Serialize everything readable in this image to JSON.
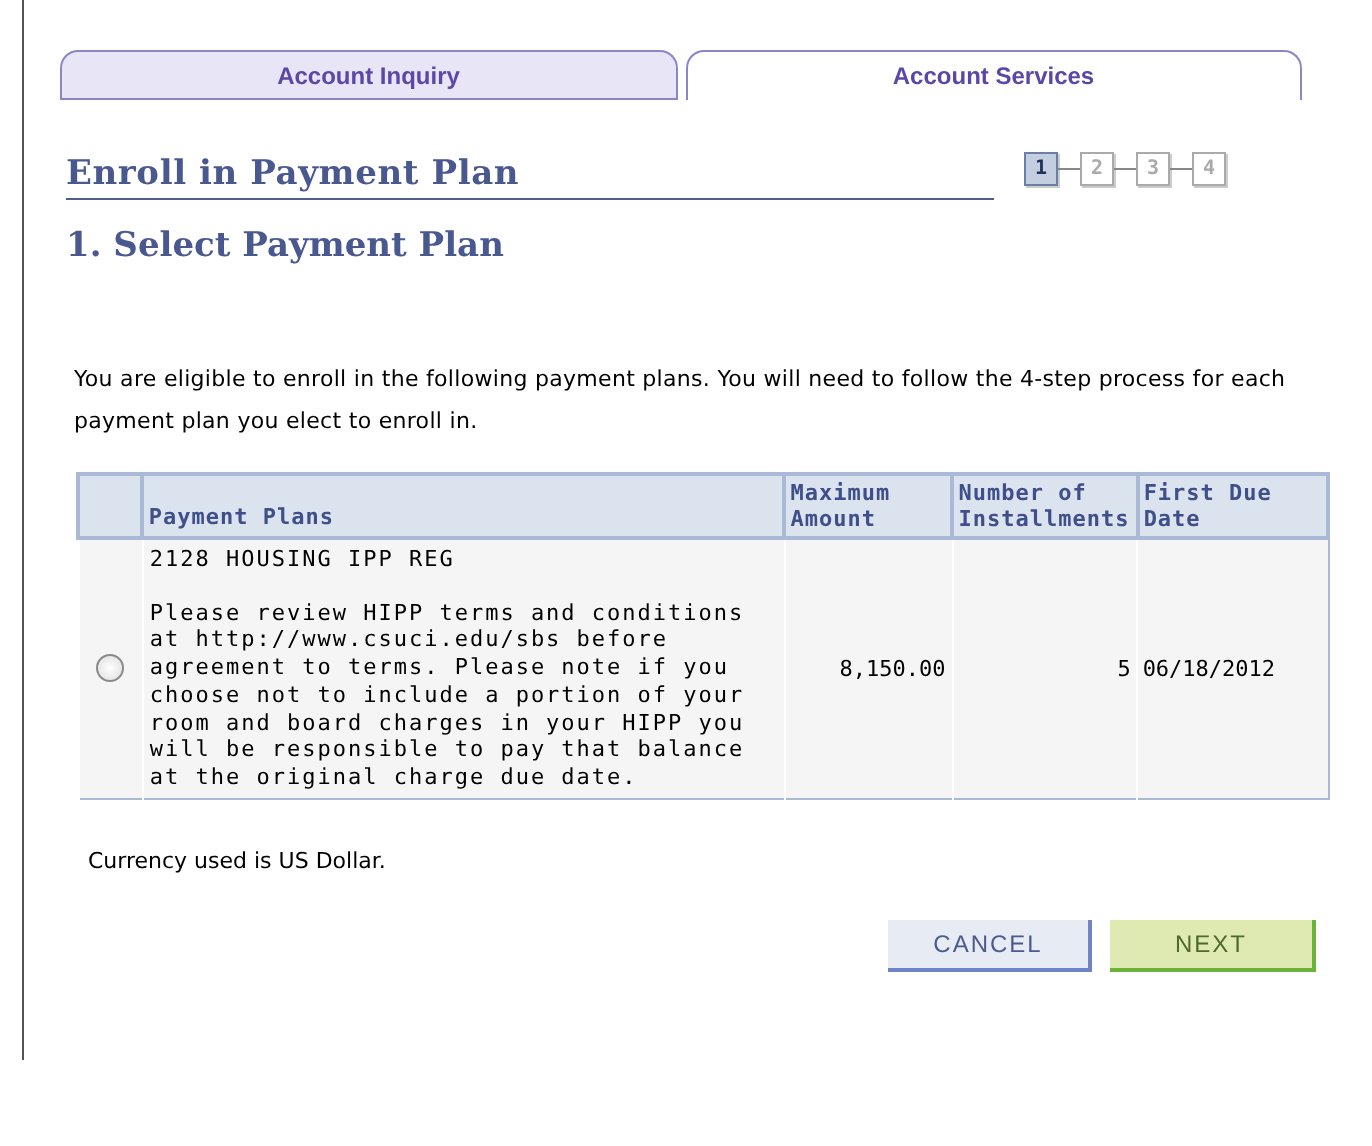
{
  "tabs": [
    {
      "label": "Account Inquiry",
      "selected": false
    },
    {
      "label": "Account Services",
      "selected": true
    }
  ],
  "page_title": "Enroll in Payment Plan",
  "steps": [
    {
      "label": "1",
      "selected": true
    },
    {
      "label": "2",
      "selected": false
    },
    {
      "label": "3",
      "selected": false
    },
    {
      "label": "4",
      "selected": false
    }
  ],
  "section_title": "1. Select Payment Plan",
  "intro": "You are eligible to enroll in the following payment plans. You will need to follow the 4-step process for each payment plan you elect to enroll in.",
  "table": {
    "columns": [
      "Payment Plans",
      "Maximum Amount",
      "Number of Installments",
      "First Due Date"
    ],
    "rows": [
      {
        "selected": false,
        "plan_name": "2128 HOUSING IPP REG",
        "plan_note": "Please review HIPP terms and conditions at http://www.csuci.edu/sbs before agreement to terms. Please note if you choose not to include a portion of your room and board charges in your HIPP you will be responsible to pay that balance at the original charge due date.",
        "amount": "8,150.00",
        "installments": "5",
        "first_due": "06/18/2012"
      }
    ]
  },
  "currency_note": "Currency used is US Dollar.",
  "buttons": [
    {
      "label": "CANCEL",
      "kind": "secondary"
    },
    {
      "label": "NEXT",
      "kind": "primary"
    }
  ]
}
